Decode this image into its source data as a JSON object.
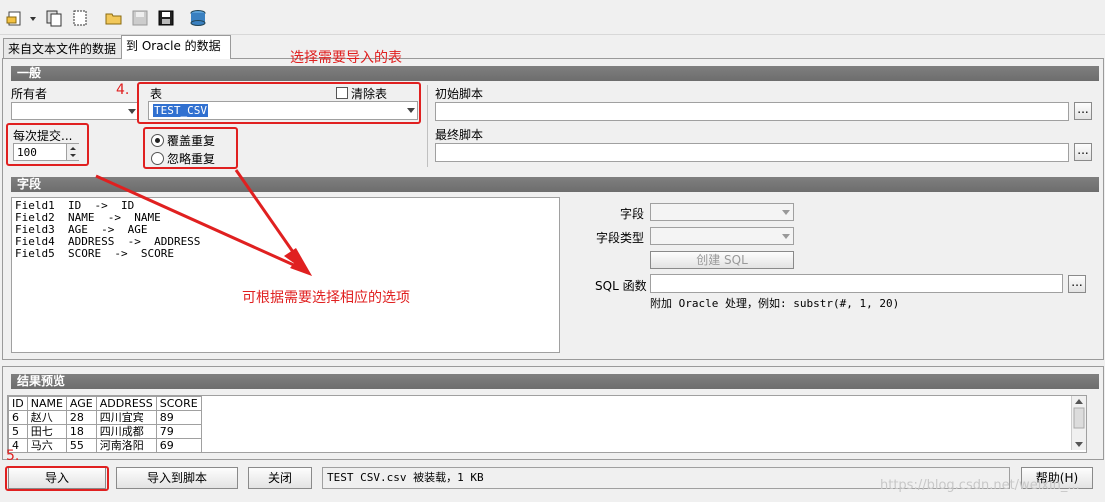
{
  "tabs": [
    {
      "label": "来自文本文件的数据"
    },
    {
      "label": "到 Oracle 的数据"
    }
  ],
  "sections": {
    "general": "一般",
    "fields": "字段",
    "preview": "结果预览"
  },
  "general": {
    "owner_label": "所有者",
    "owner_value": "",
    "table_label": "表",
    "table_value": "TEST_CSV",
    "clear_table_label": "清除表",
    "commit_label": "每次提交...",
    "commit_value": "100",
    "radio_overwrite": "覆盖重复",
    "radio_ignore": "忽略重复",
    "init_script_label": "初始脚本",
    "final_script_label": "最终脚本",
    "ellipsis": "..."
  },
  "fields": {
    "mappings": [
      "Field1  ID  ->  ID",
      "Field2  NAME  ->  NAME",
      "Field3  AGE  ->  AGE",
      "Field4  ADDRESS  ->  ADDRESS",
      "Field5  SCORE  ->  SCORE"
    ],
    "field_label": "字段",
    "field_type_label": "字段类型",
    "create_sql_button": "创建 SQL",
    "sql_func_label": "SQL 函数",
    "hint": "附加 Oracle 处理，例如:  substr(#, 1, 20)"
  },
  "preview": {
    "columns": [
      "ID",
      "NAME",
      "AGE",
      "ADDRESS",
      "SCORE"
    ],
    "rows": [
      [
        "6",
        "赵八",
        "28",
        "四川宜宾",
        "89"
      ],
      [
        "5",
        "田七",
        "18",
        "四川成都",
        "79"
      ],
      [
        "4",
        "马六",
        "55",
        "河南洛阳",
        "69"
      ]
    ]
  },
  "bottom": {
    "import_button": "导入",
    "import_to_script_button": "导入到脚本",
    "close_button": "关闭",
    "status": "TEST CSV.csv 被装载，1 KB",
    "help_button": "帮助(H)"
  },
  "annotations": {
    "step4": "4.",
    "step5": "5.",
    "select_table": "选择需要导入的表",
    "choose_options": "可根据需要选择相应的选项"
  },
  "watermark": "https://blog.csdn.net/weixin_..."
}
